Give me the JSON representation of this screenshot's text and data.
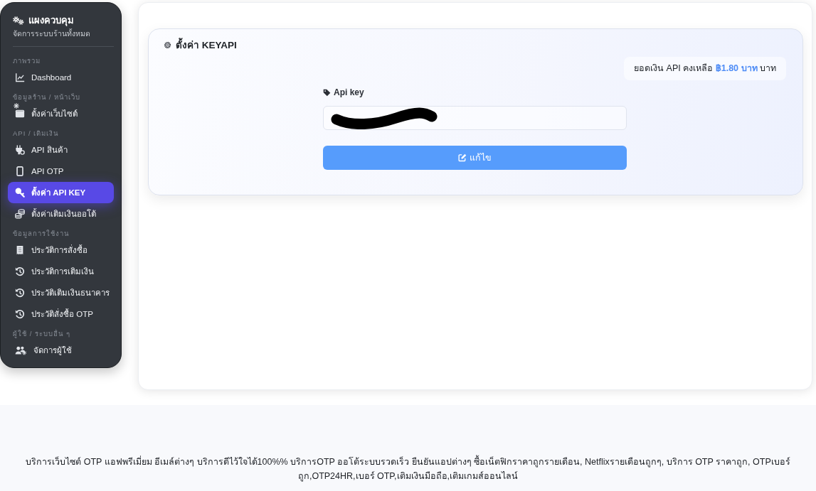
{
  "sidebar": {
    "title": "แผงควบคุม",
    "subtitle": "จัดการระบบร้านทั้งหมด",
    "sections": [
      {
        "label": "ภาพรวม",
        "items": [
          {
            "label": "Dashboard",
            "selected": false
          }
        ]
      },
      {
        "label": "ข้อมูลร้าน / หน้าเว็บ",
        "items": [
          {
            "label": "ตั้งค่าเว็บไซต์",
            "selected": false
          }
        ]
      },
      {
        "label": "API / เติมเงิน",
        "items": [
          {
            "label": "API สินค้า",
            "selected": false
          },
          {
            "label": "API OTP",
            "selected": false
          },
          {
            "label": "ตั้งค่า API KEY",
            "selected": true
          },
          {
            "label": "ตั้งค่าเติมเงินออโต้",
            "selected": false
          }
        ]
      },
      {
        "label": "ข้อมูลการใช้งาน",
        "items": [
          {
            "label": "ประวัติการสั่งซื้อ",
            "selected": false
          },
          {
            "label": "ประวัติการเติมเงิน",
            "selected": false
          },
          {
            "label": "ประวัติเติมเงินธนาคาร",
            "selected": false
          },
          {
            "label": "ประวัติสั่งซื้อ OTP",
            "selected": false
          }
        ]
      },
      {
        "label": "ผู้ใช้ / ระบบอื่น ๆ",
        "items": [
          {
            "label": "จัดการผู้ใช้",
            "selected": false
          }
        ]
      }
    ]
  },
  "card": {
    "title": "ตั้งค่า KEYAPI",
    "balance": "ยอดเงิน API คงเหลือ **฿1.80 บาท** บาท",
    "api_key_field": {
      "label": "Api key",
      "redacted": true
    },
    "button": "แก้ไข"
  },
  "footer": "บริการเว็บไซต์ OTP แอฟพรีเมี่ยม อีเมล์ต่างๆ บริการดีไว้ใจได้100%% บริการOTP ออโต้ระบบรวดเร็ว ยืนยันแอปต่างๆ ซื้อเน็ตฟิกราคาถูกรายเดือน, Netflixรายเดือนถูกๆ, บริการ OTP ราคาถูก, OTPเบอร์ถูก,OTP24HR,เบอร์ OTP,เติมเงินมือถือ,เติมเกมส์ออนไลน์"
}
